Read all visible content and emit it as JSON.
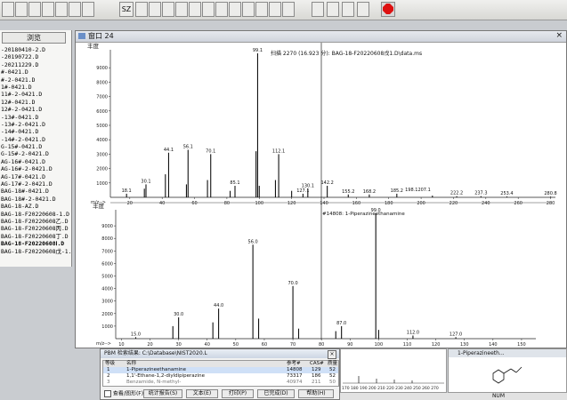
{
  "toolbar": {
    "calc_label": "SZ"
  },
  "left_panel": {
    "browse_label": "浏览",
    "files": [
      "-20180410-2.D",
      "-20190722.D",
      "-20211229.D",
      "#-0421.D",
      "#-2-0421.D",
      "1#-0421.D",
      "11#-2-0421.D",
      "12#-0421.D",
      "12#-2-0421.D",
      "-13#-0421.D",
      "-13#-2-0421.D",
      "-14#-0421.D",
      "-14#-2-0421.D",
      "G-15#-0421.D",
      "G-15#-2-0421.D",
      "AG-16#-0421.D",
      "AG-16#-2-0421.D",
      "AG-17#-0421.D",
      "AG-17#-2-0421.D",
      "BAG-18#-0421.D",
      "BAG-18#-2-0421.D",
      "BAG-18-AZ.D",
      "BAG-18-F20220608-1.D",
      "BAG-18-F20220608乙.D",
      "BAG-18-F20220608丙.D",
      "BAG-18-F20220608丁.D",
      "BAG-18-F20220608Ⅰ.D",
      "BAG-18-F20220608戊-1.D"
    ]
  },
  "window": {
    "title": "窗口 24",
    "top_plot": {
      "header": "扫描 2270 (16.923 分): BAG-18-F20220608戊1.D\\data.ms",
      "ylabel": "丰度",
      "xlabel_prefix": "m/z-->",
      "peak_label_top": "99.1"
    },
    "bottom_plot": {
      "ylabel": "丰度",
      "xlabel_prefix": "m/z-->",
      "library_label": "#14808: 1-Piperazineethanamine",
      "peak_label_top": "99.0"
    }
  },
  "chart_data": [
    {
      "type": "bar",
      "title": "扫描 2270 (16.923 分): BAG-18-F20220608戊1.D\\data.ms",
      "ylabel": "丰度",
      "xlabel": "m/z-->",
      "xlim": [
        8,
        283
      ],
      "ylim": [
        0,
        10000
      ],
      "yticks": [
        1000,
        2000,
        3000,
        4000,
        5000,
        6000,
        7000,
        8000,
        9000
      ],
      "xticks": [
        20,
        40,
        60,
        80,
        100,
        120,
        140,
        160,
        180,
        200,
        220,
        240,
        260,
        280
      ],
      "x": [
        18,
        29,
        30,
        42,
        44,
        55,
        56,
        68,
        70,
        82,
        85,
        98,
        99,
        100,
        110,
        112,
        120,
        127,
        130,
        142,
        155,
        168,
        185,
        207,
        222,
        237,
        253,
        280
      ],
      "y": [
        250,
        600,
        900,
        1600,
        3100,
        900,
        3300,
        1200,
        3000,
        450,
        800,
        3200,
        10000,
        800,
        1200,
        3000,
        450,
        250,
        600,
        800,
        200,
        200,
        250,
        120,
        80,
        80,
        60,
        50
      ],
      "peak_labels": [
        {
          "x": 18,
          "label": "18.1"
        },
        {
          "x": 30,
          "label": "30.1"
        },
        {
          "x": 44,
          "label": "44.1"
        },
        {
          "x": 56,
          "label": "56.1"
        },
        {
          "x": 70,
          "label": "70.1"
        },
        {
          "x": 85,
          "label": "85.1"
        },
        {
          "x": 99,
          "label": "99.1"
        },
        {
          "x": 112,
          "label": "112.1"
        },
        {
          "x": 127,
          "label": "127.1"
        },
        {
          "x": 130,
          "label": "130.1"
        },
        {
          "x": 142,
          "label": "142.2"
        },
        {
          "x": 155,
          "label": "155.2"
        },
        {
          "x": 168,
          "label": "168.2"
        },
        {
          "x": 185,
          "label": "185.2"
        },
        {
          "x": 198,
          "label": "198.1207.1"
        },
        {
          "x": 222,
          "label": "222.2"
        },
        {
          "x": 237,
          "label": "237.3"
        },
        {
          "x": 253,
          "label": "253.4"
        },
        {
          "x": 280,
          "label": "280.8"
        }
      ]
    },
    {
      "type": "bar",
      "title": "#14808: 1-Piperazineethanamine",
      "ylabel": "丰度",
      "xlabel": "m/z-->",
      "xlim": [
        8,
        155
      ],
      "ylim": [
        0,
        10000
      ],
      "yticks": [
        1000,
        2000,
        3000,
        4000,
        5000,
        6000,
        7000,
        8000,
        9000
      ],
      "xticks": [
        10,
        20,
        30,
        40,
        50,
        60,
        70,
        80,
        90,
        100,
        110,
        120,
        130,
        140,
        150
      ],
      "x": [
        15,
        28,
        30,
        42,
        44,
        56,
        58,
        70,
        72,
        85,
        87,
        99,
        100,
        112,
        127
      ],
      "y": [
        120,
        1000,
        1700,
        1300,
        2400,
        7500,
        1600,
        4200,
        800,
        600,
        1000,
        10000,
        700,
        250,
        120
      ],
      "peak_labels": [
        {
          "x": 15,
          "label": "15.0"
        },
        {
          "x": 30,
          "label": "30.0"
        },
        {
          "x": 44,
          "label": "44.0"
        },
        {
          "x": 56,
          "label": "56.0"
        },
        {
          "x": 70,
          "label": "70.0"
        },
        {
          "x": 87,
          "label": "87.0"
        },
        {
          "x": 99,
          "label": "99.0"
        },
        {
          "x": 112,
          "label": "112.0"
        },
        {
          "x": 127,
          "label": "127.0"
        }
      ]
    }
  ],
  "dialog": {
    "title": "PBM 检索结果: C:\\Database\\NIST2020.L",
    "headers": [
      "等级",
      "名称",
      "参考#",
      "CAS#",
      "质量"
    ],
    "rows": [
      [
        "1",
        "1-Piperazineethanamine",
        "14808",
        "129",
        "52"
      ],
      [
        "2",
        "1,1'-Ethane-1,2-diyldipiperazine",
        "73317",
        "186",
        "52"
      ],
      [
        "3",
        "Benzamide, N-methyl-",
        "40974",
        "211",
        "50"
      ]
    ],
    "checkbox_label": "查看/图形(F)",
    "buttons": [
      "统计报告(S)",
      "文本(E)",
      "打印(P)",
      "已完成(D)",
      "帮助(H)"
    ]
  },
  "mini_plot": {
    "tick_labels": [
      "170",
      "180",
      "190",
      "200",
      "210",
      "220",
      "230",
      "240",
      "250",
      "260",
      "270"
    ]
  },
  "structure": {
    "title": "1-Piperazineeth..."
  },
  "status": {
    "num": "NUM"
  }
}
